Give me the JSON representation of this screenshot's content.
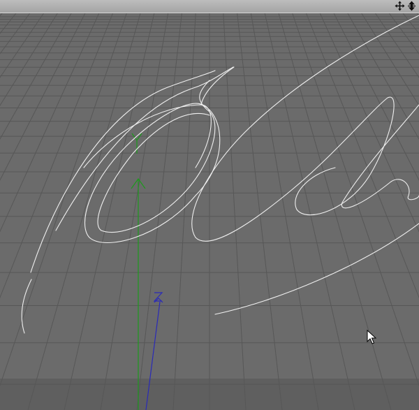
{
  "viewport": {
    "toolbar": {
      "move_icon": "move-arrows-icon",
      "zoom_icon": "vertical-arrows-icon"
    },
    "axes": {
      "y_axis_label": "Y",
      "z_axis_label": "Z",
      "y_axis_color": "#1c9a1c",
      "z_axis_color": "#2a2ab8"
    },
    "colors": {
      "background": "#6b6b6b",
      "grid": "#565656",
      "curves": "#f2f2f2"
    }
  }
}
